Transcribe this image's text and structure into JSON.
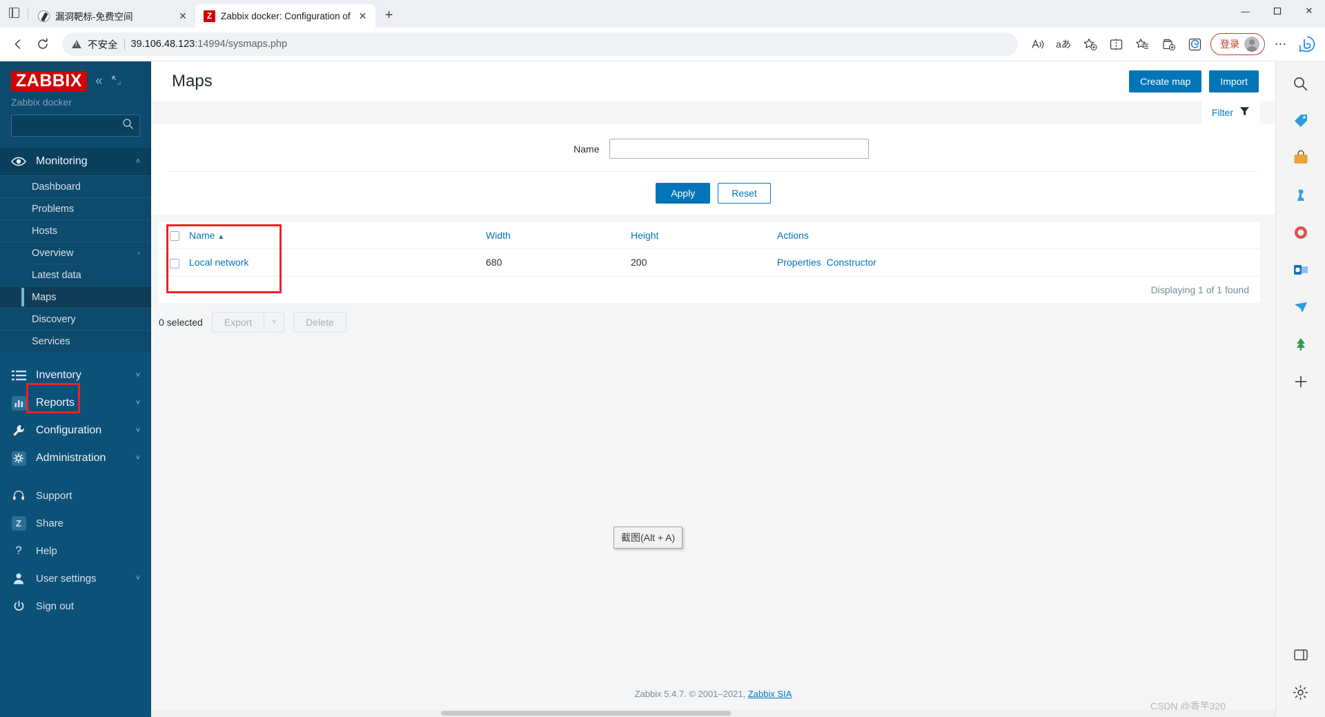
{
  "browser": {
    "tabs": [
      {
        "title": "漏洞靶标-免费空间",
        "favicon": "globe-icon",
        "active": false,
        "close_label": "✕"
      },
      {
        "title": "Zabbix docker: Configuration of",
        "favicon": "zabbix-favicon",
        "active": true,
        "close_label": "✕"
      }
    ],
    "new_tab_label": "+",
    "tab_search_icon": "tab-list-icon",
    "nav": {
      "back_icon": "back-arrow-icon",
      "reload_icon": "reload-icon",
      "security_label": "不安全",
      "url_host": "39.106.48.123",
      "url_path": ":14994/sysmaps.php",
      "read_aloud_icon": "read-aloud-icon",
      "translate_icon": "translate-icon",
      "add_favorite_icon": "add-favorite-icon",
      "split_screen_icon": "split-screen-icon",
      "favorites_icon": "favorites-icon",
      "collections_icon": "collections-icon",
      "browser_essentials_icon": "browser-essentials-icon",
      "signin_label": "登录",
      "avatar_icon": "avatar-icon",
      "settings_more_icon": "more-options-icon",
      "copilot_icon": "bing-copilot-icon"
    },
    "window": {
      "minimize": "—",
      "maximize": "☐",
      "close": "✕"
    }
  },
  "sidebar": {
    "logo_text": "ZABBIX",
    "collapse_icon": "collapse-sidebar-icon",
    "hide_icon": "hide-sidebar-icon",
    "server_name": "Zabbix docker",
    "search_placeholder": "",
    "search_value": "",
    "search_icon": "search-icon",
    "sections": [
      {
        "label": "Monitoring",
        "icon": "eye-icon",
        "expanded": true,
        "chevron": "˄",
        "items": [
          {
            "label": "Dashboard",
            "selected": false,
            "chevron": ""
          },
          {
            "label": "Problems",
            "selected": false,
            "chevron": ""
          },
          {
            "label": "Hosts",
            "selected": false,
            "chevron": ""
          },
          {
            "label": "Overview",
            "selected": false,
            "chevron": "›"
          },
          {
            "label": "Latest data",
            "selected": false,
            "chevron": ""
          },
          {
            "label": "Maps",
            "selected": true,
            "chevron": ""
          },
          {
            "label": "Discovery",
            "selected": false,
            "chevron": ""
          },
          {
            "label": "Services",
            "selected": false,
            "chevron": ""
          }
        ]
      }
    ],
    "main_items": [
      {
        "label": "Inventory",
        "icon": "list-icon",
        "chevron": "˅"
      },
      {
        "label": "Reports",
        "icon": "bar-chart-icon",
        "chevron": "˅"
      },
      {
        "label": "Configuration",
        "icon": "wrench-icon",
        "chevron": "˅"
      },
      {
        "label": "Administration",
        "icon": "gear-icon",
        "chevron": "˅"
      }
    ],
    "bottom_items": [
      {
        "label": "Support",
        "icon": "headset-icon",
        "chevron": ""
      },
      {
        "label": "Share",
        "icon": "zabbix-share-icon",
        "chevron": ""
      },
      {
        "label": "Help",
        "icon": "question-icon",
        "chevron": ""
      },
      {
        "label": "User settings",
        "icon": "user-icon",
        "chevron": "˅"
      },
      {
        "label": "Sign out",
        "icon": "power-icon",
        "chevron": ""
      }
    ]
  },
  "page": {
    "title": "Maps",
    "create_button": "Create map",
    "import_button": "Import",
    "filter_tab_label": "Filter",
    "filter_icon": "funnel-icon"
  },
  "filter": {
    "name_label": "Name",
    "name_value": "",
    "name_placeholder": "",
    "apply_label": "Apply",
    "reset_label": "Reset"
  },
  "table": {
    "columns": [
      "Name",
      "Width",
      "Height",
      "Actions"
    ],
    "sort_column": "Name",
    "sort_arrow": "▲",
    "select_all_checkbox": false,
    "rows": [
      {
        "checked": false,
        "name": "Local network",
        "width": "680",
        "height": "200",
        "actions": [
          "Properties",
          "Constructor"
        ]
      }
    ],
    "footer_text": "Displaying 1 of 1 found"
  },
  "bulk": {
    "selected_text": "0 selected",
    "export_label": "Export",
    "export_caret": "˅",
    "delete_label": "Delete"
  },
  "tooltip": {
    "text": "截图(Alt + A)"
  },
  "footer": {
    "text": "Zabbix 5.4.7. © 2001–2021, ",
    "link": "Zabbix SIA"
  },
  "watermark": {
    "text": "CSDN @香芋320"
  },
  "edge_rail": {
    "icons": [
      {
        "name": "search-icon",
        "glyph": "⌕"
      },
      {
        "name": "shopping-tag-icon",
        "glyph": "◆"
      },
      {
        "name": "shopping-bag-icon",
        "glyph": "▬"
      },
      {
        "name": "games-icon",
        "glyph": "♞"
      },
      {
        "name": "office-icon",
        "glyph": "●"
      },
      {
        "name": "outlook-icon",
        "glyph": "◑"
      },
      {
        "name": "drop-icon",
        "glyph": "▲"
      },
      {
        "name": "tree-icon",
        "glyph": "▲"
      },
      {
        "name": "add-icon",
        "glyph": "＋"
      }
    ],
    "bottom_icons": [
      {
        "name": "sidebar-panel-icon",
        "glyph": "□"
      },
      {
        "name": "settings-gear-icon",
        "glyph": "⚙"
      }
    ]
  },
  "colors": {
    "zabbix_red": "#d40000",
    "zabbix_blue": "#0275b8",
    "sidebar_bg": "#0c5178",
    "annotation_red": "#ee2222"
  }
}
